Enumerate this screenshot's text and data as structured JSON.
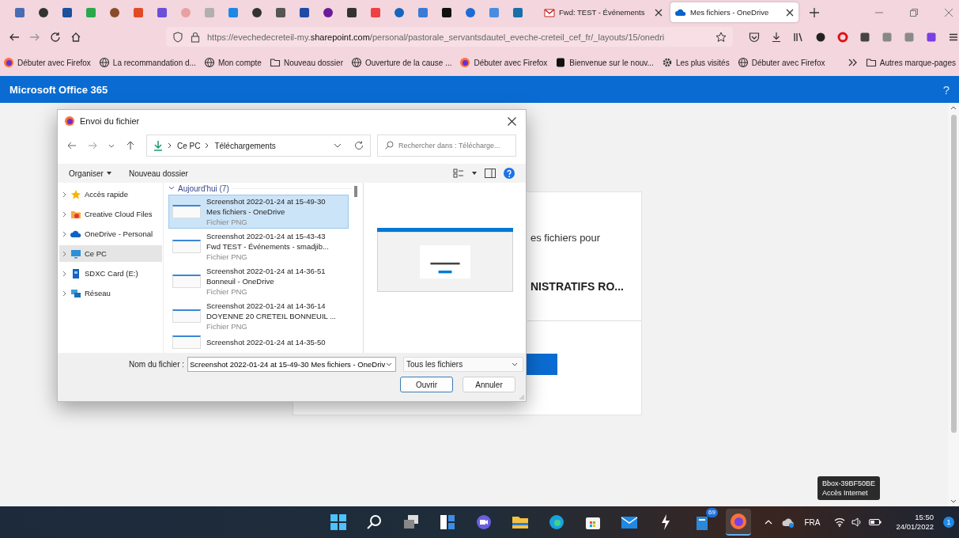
{
  "browser": {
    "tabs": [
      {
        "title": "Fwd: TEST - Événements",
        "kind": "mail",
        "selected": false
      },
      {
        "title": "Mes fichiers - OneDrive",
        "kind": "cloud",
        "selected": true
      }
    ],
    "url": "https://evechedecreteil-my.**sharepoint.com**/personal/pastorale_servantsdautel_eveche-creteil_cef_fr/_layouts/15/onedri",
    "bookmarks": [
      {
        "label": "Débuter avec Firefox",
        "kind": "firefox"
      },
      {
        "label": "La recommandation d...",
        "kind": "globe"
      },
      {
        "label": "Mon compte",
        "kind": "globe"
      },
      {
        "label": "Nouveau dossier",
        "kind": "folder"
      },
      {
        "label": "Ouverture de la cause ...",
        "kind": "globe"
      },
      {
        "label": "Débuter avec Firefox",
        "kind": "firefox"
      },
      {
        "label": "Bienvenue sur le nouv...",
        "kind": "app"
      },
      {
        "label": "Les plus visités",
        "kind": "gear"
      },
      {
        "label": "Débuter avec Firefox",
        "kind": "globe"
      }
    ],
    "other_bookmarks": "Autres marque-pages"
  },
  "app_bar": {
    "title": "Microsoft Office 365",
    "help": "?"
  },
  "page_card": {
    "line": "es fichiers pour",
    "title": "NISTRATIFS RO..."
  },
  "dialog": {
    "title": "Envoi du fichier",
    "path": [
      "Ce PC",
      "Téléchargements"
    ],
    "search_placeholder": "Rechercher dans : Télécharge...",
    "toolbar": [
      "Organiser",
      "Nouveau dossier"
    ],
    "nav_items": [
      {
        "label": "Accès rapide",
        "kind": "star",
        "selected": false
      },
      {
        "label": "Creative Cloud Files",
        "kind": "ccfiles",
        "selected": false
      },
      {
        "label": "OneDrive - Personal",
        "kind": "cloud",
        "selected": false
      },
      {
        "label": "Ce PC",
        "kind": "pc",
        "selected": true
      },
      {
        "label": "SDXC Card (E:)",
        "kind": "sd",
        "selected": false
      },
      {
        "label": "Réseau",
        "kind": "network",
        "selected": false
      }
    ],
    "group": "Aujourd'hui (7)",
    "files": [
      {
        "line1": "Screenshot 2022-01-24 at 15-49-30",
        "line2": "Mes fichiers - OneDrive",
        "type": "Fichier PNG",
        "selected": true
      },
      {
        "line1": "Screenshot 2022-01-24 at 15-43-43",
        "line2": "Fwd TEST - Événements - smadjib...",
        "type": "Fichier PNG",
        "selected": false
      },
      {
        "line1": "Screenshot 2022-01-24 at 14-36-51",
        "line2": "Bonneuil - OneDrive",
        "type": "Fichier PNG",
        "selected": false
      },
      {
        "line1": "Screenshot 2022-01-24 at 14-36-14",
        "line2": "DOYENNE 20 CRETEIL BONNEUIL ...",
        "type": "Fichier PNG",
        "selected": false
      },
      {
        "line1": "Screenshot 2022-01-24 at 14-35-50",
        "selected": false
      }
    ],
    "filename_label": "Nom du fichier :",
    "filename": "Screenshot 2022-01-24 at 15-49-30 Mes fichiers - OneDriv",
    "filetype": "Tous les fichiers",
    "buttons": [
      "Ouvrir",
      "Annuler"
    ]
  },
  "tooltip": {
    "lines": [
      "Bbox-39BF50BE",
      "Accès Internet"
    ]
  },
  "taskbar": {
    "badge": "69",
    "language": "FRA",
    "time": "15:50",
    "date": "24/01/2022",
    "notifications": "1"
  }
}
